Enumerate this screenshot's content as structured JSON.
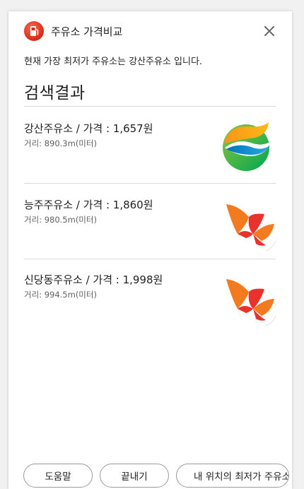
{
  "app": {
    "title": "주유소 가격비교",
    "icon": "fuel-pump-icon"
  },
  "summary": "현재 가장 최저가 주유소는 강산주유소 입니다.",
  "heading": "검색결과",
  "results": [
    {
      "title": "강산주유소 / 가격 : 1,657원",
      "distance": "거리: 890.3m(미터)",
      "logo": "s-oil-logo"
    },
    {
      "title": "능주주유소 / 가격 : 1,860원",
      "distance": "거리: 980.5m(미터)",
      "logo": "sk-energy-logo"
    },
    {
      "title": "신당동주유소 / 가격 : 1,998원",
      "distance": "거리: 994.5m(미터)",
      "logo": "sk-energy-logo"
    }
  ],
  "footer": {
    "help": "도움말",
    "quit": "끝내기",
    "nearby": "내 위치의 최저가 주유소"
  },
  "colors": {
    "accent": "#e53c1f",
    "sk_orange": "#f47a20",
    "sk_red": "#e8322b",
    "soil_yellow": "#fdb913",
    "soil_green": "#00a650",
    "soil_blue": "#0072bc"
  }
}
